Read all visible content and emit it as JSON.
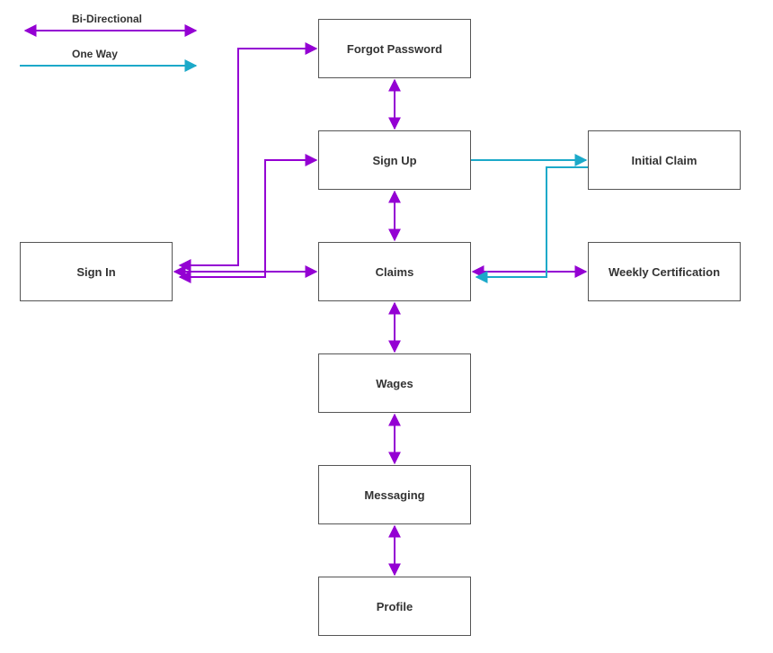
{
  "legend": {
    "bidirectional": "Bi-Directional",
    "oneway": "One Way"
  },
  "nodes": {
    "forgot_password": "Forgot Password",
    "sign_up": "Sign Up",
    "initial_claim": "Initial Claim",
    "sign_in": "Sign In",
    "claims": "Claims",
    "weekly_cert": "Weekly Certification",
    "wages": "Wages",
    "messaging": "Messaging",
    "profile": "Profile"
  },
  "colors": {
    "bidirectional": "#9400D3",
    "oneway": "#1CA9C9",
    "node_border": "#555555"
  },
  "edges": [
    {
      "from": "forgot_password",
      "to": "sign_up",
      "type": "bidirectional"
    },
    {
      "from": "sign_up",
      "to": "claims",
      "type": "bidirectional"
    },
    {
      "from": "claims",
      "to": "wages",
      "type": "bidirectional"
    },
    {
      "from": "wages",
      "to": "messaging",
      "type": "bidirectional"
    },
    {
      "from": "messaging",
      "to": "profile",
      "type": "bidirectional"
    },
    {
      "from": "sign_in",
      "to": "claims",
      "type": "bidirectional"
    },
    {
      "from": "claims",
      "to": "weekly_cert",
      "type": "bidirectional"
    },
    {
      "from": "sign_in",
      "to": "forgot_password",
      "type": "bidirectional",
      "note": "routed up-right"
    },
    {
      "from": "sign_in",
      "to": "sign_up",
      "type": "bidirectional",
      "note": "routed up-right"
    },
    {
      "from": "sign_up",
      "to": "initial_claim",
      "type": "oneway"
    },
    {
      "from": "initial_claim",
      "to": "claims",
      "type": "oneway",
      "note": "routed down-left"
    }
  ]
}
